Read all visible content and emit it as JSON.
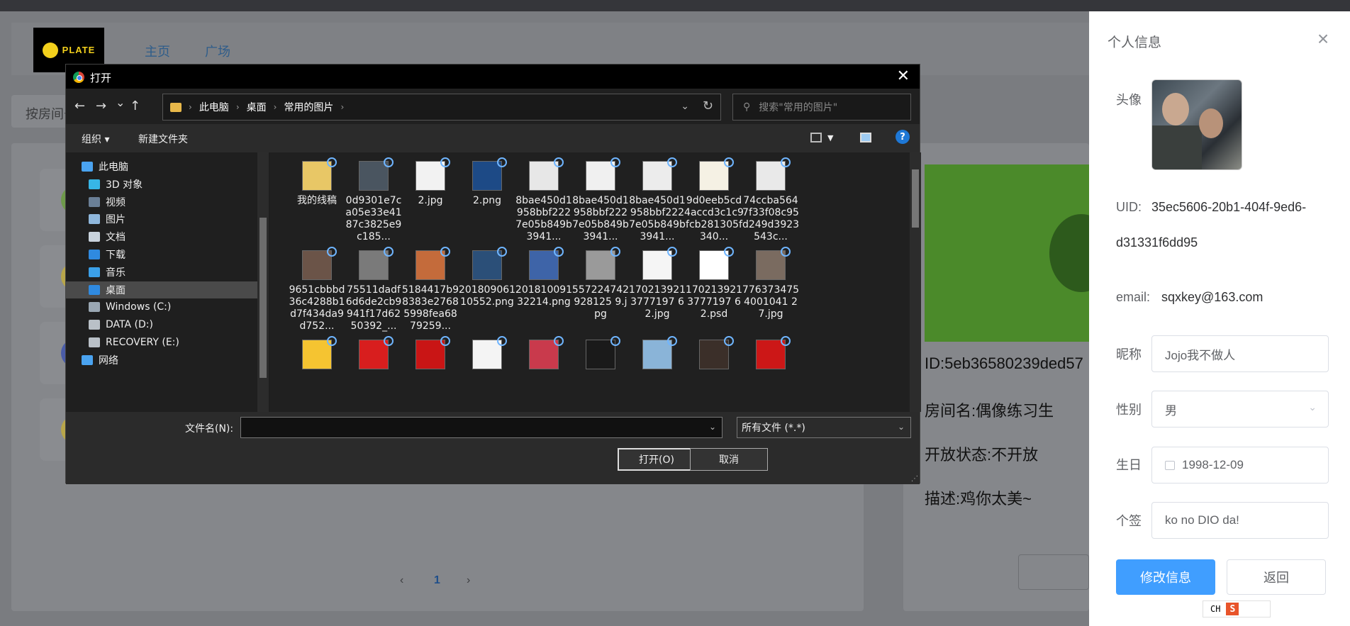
{
  "site": {
    "logo_text": "PLATE",
    "nav": [
      "主页",
      "广场"
    ],
    "filter_placeholder": "按房间号",
    "pager_current": "1",
    "pager_prev": "‹",
    "pager_next": "›",
    "room": {
      "id_line": "ID:5eb36580239ded57",
      "name_line": "房间名:偶像练习生",
      "status_line": "开放状态:不开放",
      "desc_line": "描述:鸡你太美~"
    }
  },
  "drawer": {
    "title": "个人信息",
    "close": "×",
    "avatar_label": "头像",
    "uid_label": "UID:",
    "uid_line1": "35ec5606-20b1-404f-9ed6-",
    "uid_line2": "d31331f6dd95",
    "email_label": "email:",
    "email_value": "sqxkey@163.com",
    "nickname_label": "昵称",
    "nickname_value": "Jojo我不做人",
    "gender_label": "性别",
    "gender_value": "男",
    "birthday_label": "生日",
    "birthday_value": "1998-12-09",
    "signature_label": "个签",
    "signature_value": "ko no DIO da!",
    "modify_button": "修改信息",
    "back_button": "返回",
    "ime_text": "CH",
    "ime_logo": "S"
  },
  "dialog": {
    "title": "打开",
    "close": "✕",
    "nav_back": "←",
    "nav_forward": "→",
    "nav_recent": "⌄",
    "nav_up": "↑",
    "breadcrumb": [
      "此电脑",
      "桌面",
      "常用的图片"
    ],
    "search_placeholder": "搜索\"常用的图片\"",
    "organize": "组织 ▾",
    "new_folder": "新建文件夹",
    "help": "?",
    "tree": [
      {
        "label": "此电脑",
        "color": "#4aa3f0"
      },
      {
        "label": "3D 对象",
        "color": "#37b6e6"
      },
      {
        "label": "视频",
        "color": "#6a7f96"
      },
      {
        "label": "图片",
        "color": "#8fb7dc"
      },
      {
        "label": "文档",
        "color": "#c9d3dd"
      },
      {
        "label": "下载",
        "color": "#2f8ae0"
      },
      {
        "label": "音乐",
        "color": "#3ba0e8"
      },
      {
        "label": "桌面",
        "color": "#2f8ae0"
      },
      {
        "label": "Windows (C:)",
        "color": "#9aa7b3"
      },
      {
        "label": "DATA (D:)",
        "color": "#b9c0c7"
      },
      {
        "label": "RECOVERY (E:)",
        "color": "#b9c0c7"
      },
      {
        "label": "网络",
        "color": "#4aa3f0"
      }
    ],
    "files": [
      {
        "name": "我的线稿",
        "thumb": "#e8c766"
      },
      {
        "name": "0d9301e7ca05e33e4187c3825e9c185...",
        "thumb": "#4a5560"
      },
      {
        "name": "2.jpg",
        "thumb": "#f2f2f2"
      },
      {
        "name": "2.png",
        "thumb": "#1d4a86"
      },
      {
        "name": "8bae450d1958bbf2227e05b849b3941...",
        "thumb": "#e7e7e7"
      },
      {
        "name": "8bae450d1958bbf2227e05b849b3941...",
        "thumb": "#f0f0f0"
      },
      {
        "name": "8bae450d1958bbf2227e05b849b3941...",
        "thumb": "#ececec"
      },
      {
        "name": "9d0eeb5cd4accd3c1c9fcb281305f340...",
        "thumb": "#f5f1e4"
      },
      {
        "name": "74ccba5647f33f08c95d249d3923543c...",
        "thumb": "#e9e9e9"
      },
      {
        "name": "9651cbbbd36c4288b1d7f434da9d752...",
        "thumb": "#6b5448"
      },
      {
        "name": "75511dadf6d6de2cb9941f17d6250392_...",
        "thumb": "#7a7a7a"
      },
      {
        "name": "5184417b98383e27685998fea6879259...",
        "thumb": "#c46b3b"
      },
      {
        "name": "20180906110552.png",
        "thumb": "#2b4f78"
      },
      {
        "name": "20181009132214.png",
        "thumb": "#3e64a8"
      },
      {
        "name": "557224742928125 9.jpg",
        "thumb": "#9a9a9a"
      },
      {
        "name": "1702139213777197 62.jpg",
        "thumb": "#f5f5f5"
      },
      {
        "name": "1702139213777197 62.psd",
        "thumb": "#ffffff"
      },
      {
        "name": "7763734754001041 27.jpg",
        "thumb": "#7a6b60"
      },
      {
        "name": "",
        "thumb": "#f5c431"
      },
      {
        "name": "",
        "thumb": "#d81e1e"
      },
      {
        "name": "",
        "thumb": "#c91515"
      },
      {
        "name": "",
        "thumb": "#f4f4f4"
      },
      {
        "name": "",
        "thumb": "#c93a4c"
      },
      {
        "name": "",
        "thumb": "#1a1a1a"
      },
      {
        "name": "",
        "thumb": "#8ab4d8"
      },
      {
        "name": "",
        "thumb": "#3b2f29"
      },
      {
        "name": "",
        "thumb": "#cc1717"
      }
    ],
    "file_name_label": "文件名(N):",
    "file_name_value": "",
    "file_type": "所有文件 (*.*)",
    "open_button": "打开(O)",
    "cancel_button": "取消"
  }
}
